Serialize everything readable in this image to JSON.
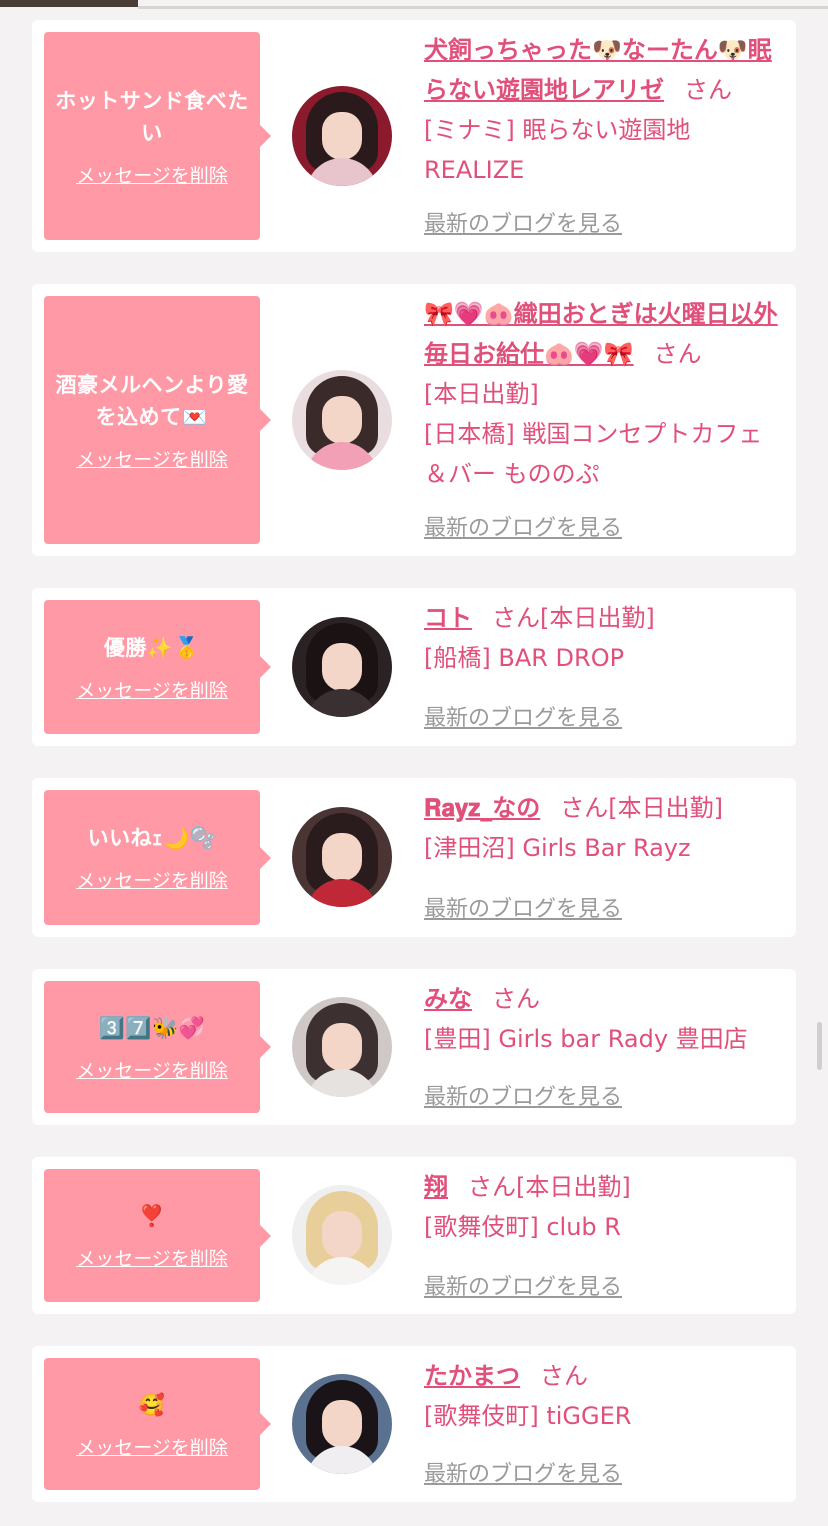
{
  "colors": {
    "accent": "#e0507a",
    "bubble": "#ff99a6",
    "muted": "#9a9a9a"
  },
  "entries": [
    {
      "message": "ホットサンド食べたい",
      "delete_label": "メッセージを削除",
      "name": "犬飼っちゃった🐶なーたん🐶眠らない遊園地レアリゼ",
      "san": "さん",
      "status": "",
      "shop": "[ミナミ] 眠らない遊園地REALIZE",
      "blog_label": "最新のブログを見る"
    },
    {
      "message": "酒豪メルヘンより愛を込めて💌",
      "delete_label": "メッセージを削除",
      "name": "🎀💗🐽織田おとぎは火曜日以外毎日お給仕🐽💗🎀",
      "san": "さん",
      "status": "[本日出勤]",
      "shop": "[日本橋] 戦国コンセプトカフェ＆バー もののぷ",
      "blog_label": "最新のブログを見る"
    },
    {
      "message": "優勝✨🥇",
      "delete_label": "メッセージを削除",
      "name": "コト",
      "san": "さん",
      "status": "[本日出勤]",
      "shop": "[船橋] BAR DROP",
      "blog_label": "最新のブログを見る"
    },
    {
      "message": "いいねｪ🌙🫧",
      "delete_label": "メッセージを削除",
      "name": "𝐑𝐚𝐲𝐳_なの",
      "san": "さん",
      "status": "[本日出勤]",
      "shop": "[津田沼] Girls Bar Rayz",
      "blog_label": "最新のブログを見る"
    },
    {
      "message": "3️⃣7️⃣🐝💞",
      "delete_label": "メッセージを削除",
      "name": "みな",
      "san": "さん",
      "status": "",
      "shop": "[豊田] Girls bar Rady 豊田店",
      "blog_label": "最新のブログを見る"
    },
    {
      "message": "❣️",
      "delete_label": "メッセージを削除",
      "name": "翔",
      "san": "さん",
      "status": "[本日出勤]",
      "shop": "[歌舞伎町] club R",
      "blog_label": "最新のブログを見る"
    },
    {
      "message": "🥰",
      "delete_label": "メッセージを削除",
      "name": "たかまつ",
      "san": "さん",
      "status": "",
      "shop": "[歌舞伎町] tiGGER",
      "blog_label": "最新のブログを見る"
    }
  ]
}
